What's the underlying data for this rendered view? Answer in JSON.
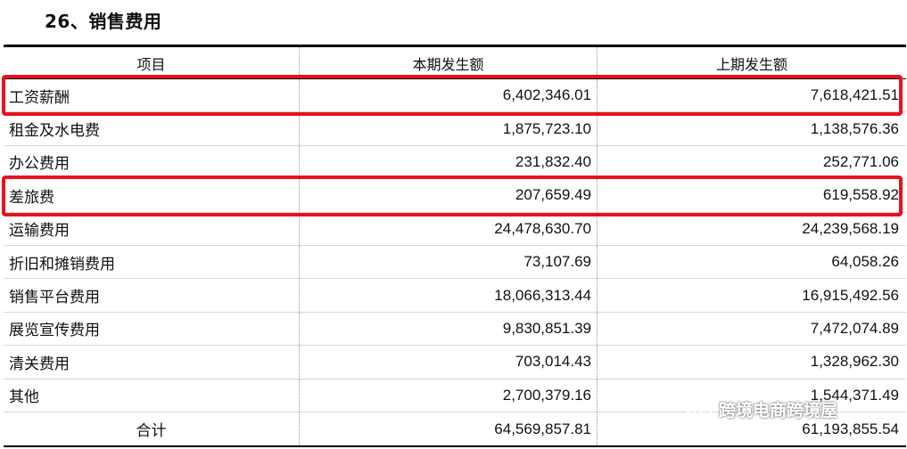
{
  "heading": "26、销售费用",
  "table": {
    "columns": [
      "项目",
      "本期发生额",
      "上期发生额"
    ],
    "rows": [
      {
        "item": "工资薪酬",
        "current": "6,402,346.01",
        "previous": "7,618,421.51"
      },
      {
        "item": "租金及水电费",
        "current": "1,875,723.10",
        "previous": "1,138,576.36"
      },
      {
        "item": "办公费用",
        "current": "231,832.40",
        "previous": "252,771.06"
      },
      {
        "item": "差旅费",
        "current": "207,659.49",
        "previous": "619,558.92"
      },
      {
        "item": "运输费用",
        "current": "24,478,630.70",
        "previous": "24,239,568.19"
      },
      {
        "item": "折旧和摊销费用",
        "current": "73,107.69",
        "previous": "64,058.26"
      },
      {
        "item": "销售平台费用",
        "current": "18,066,313.44",
        "previous": "16,915,492.56"
      },
      {
        "item": "展览宣传费用",
        "current": "9,830,851.39",
        "previous": "7,472,074.89"
      },
      {
        "item": "清关费用",
        "current": "703,014.43",
        "previous": "1,328,962.30"
      },
      {
        "item": "其他",
        "current": "2,700,379.16",
        "previous": "1,544,371.49"
      },
      {
        "item": "合计",
        "current": "64,569,857.81",
        "previous": "61,193,855.54"
      }
    ]
  },
  "highlight_color": "#e8121c",
  "watermark": {
    "text": "跨境电商跨境屋",
    "icon": "wechat-icon"
  }
}
